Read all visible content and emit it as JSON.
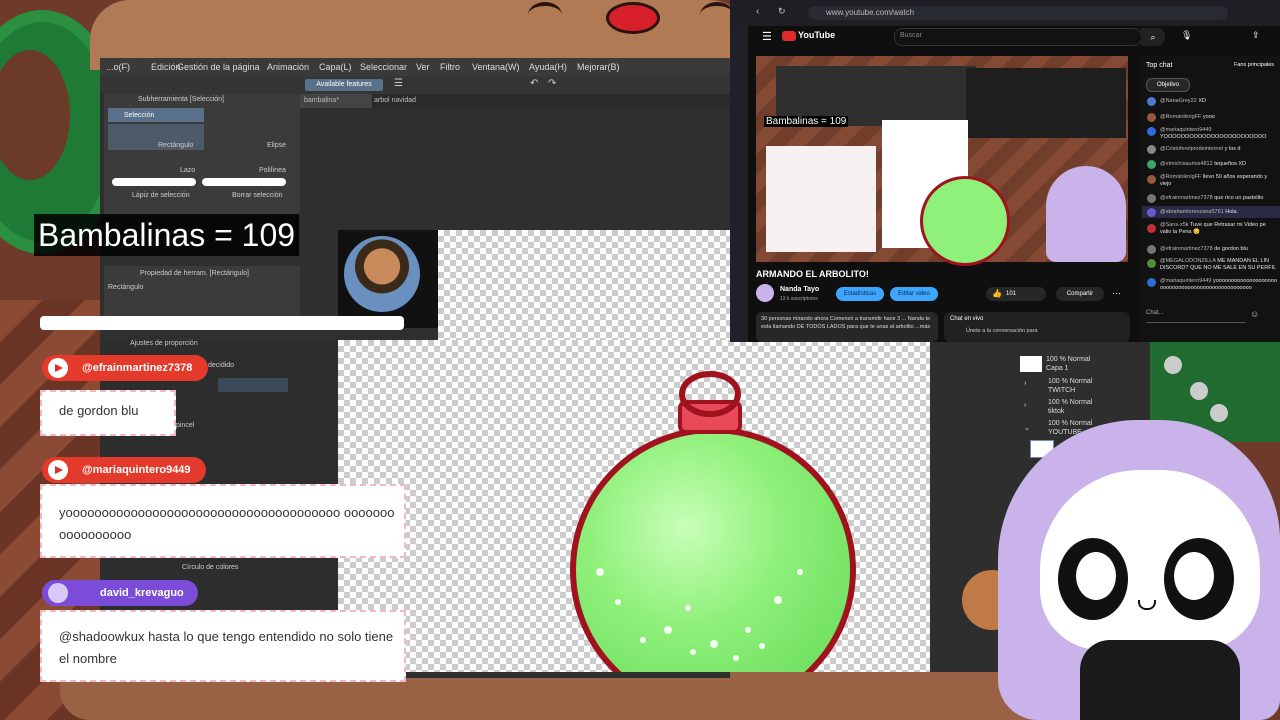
{
  "overlay": {
    "counter": "Bambalinas = 109"
  },
  "clipstudio": {
    "menu": [
      "...o(F)",
      "Edición",
      "Gestión de la página",
      "Animación",
      "Capa(L)",
      "Seleccionar",
      "Ver",
      "Filtro",
      "Ventana(W)",
      "Ayuda(H)",
      "Mejorar(B)"
    ],
    "available_features": "Available features",
    "tab_active": "bambalina*",
    "tab_inactive": "arbol navidad",
    "subtool_header": "Subherramienta [Selección]",
    "subtool_group": "Selección",
    "tools": [
      "Rectángulo",
      "Elipse",
      "Lazo",
      "Polilínea",
      "Lápiz de selección",
      "Borrar selección"
    ],
    "tool_property_header": "Propiedad de herram. [Rectángulo]",
    "tool_property_value": "Rectángulo",
    "proportion_label": "Ajustes de proporción",
    "decided_label": "decidido",
    "brush_label": "pincel",
    "color_circle_label": "Círculo de colores"
  },
  "chat_overlay": [
    {
      "user": "@efrainmartinez7378",
      "platform": "youtube",
      "message": "de gordon blu"
    },
    {
      "user": "@mariaquintero9449",
      "platform": "youtube",
      "message": "yoooooooooooooooooooooooooooooooooooooo ooooooooooooooooo"
    },
    {
      "user": "david_krevaguo",
      "platform": "twitch",
      "message": "@shadoowkux hasta lo que tengo entendido no solo tiene el nombre"
    }
  ],
  "youtube": {
    "url": "www.youtube.com/watch",
    "brand": "YouTube",
    "search_placeholder": "Buscar",
    "video_overlay_text": "Bambalinas = 109",
    "title": "ARMANDO EL ARBOLITO!",
    "channel": "Nanda Tayo",
    "subscribers": "13 k suscriptores",
    "btn_stats": "Estadísticas",
    "btn_edit": "Editar video",
    "likes": "101",
    "share": "Compartir",
    "description": "30 personas mirando ahora  Comenzó a transmitir hace 3 ... Nanda te esta llamando DE TODOS LADOS para que te unas al arbolito ...más",
    "live_chat_label": "Chat en vivo",
    "live_chat_join": "Únete a la conversación para",
    "top_chat": "Top chat",
    "top_fans": "Fans principales",
    "objective": "Objetivo",
    "chat_placeholder": "Chat...",
    "chat": [
      {
        "user": "@NanaGrey22",
        "msg": "XD",
        "color": "#4a7bd0"
      },
      {
        "user": "@RomániknigFF",
        "msg": "yooo",
        "color": "#9a5a3a"
      },
      {
        "user": "@mariaquintero9449",
        "msg": "YOOOOOOOOOOOOOOOOOOOOOOOO",
        "color": "#2d6bd6"
      },
      {
        "user": "@Cristoferelprodeinternet",
        "msg": "y los d",
        "color": "#888888"
      },
      {
        "user": "@elmichisaurios4812",
        "msg": "tequeños XD",
        "color": "#3aa66a"
      },
      {
        "user": "@RomániknigFF",
        "msg": "llevo 50 años esperando y viejo",
        "color": "#9a5a3a"
      },
      {
        "user": "@efrainmartinez7378",
        "msg": "que rico un pastelito",
        "color": "#777777"
      },
      {
        "user": "@abrahamlorenzana5761",
        "msg": "Hola.",
        "color": "#6a5acd"
      },
      {
        "user": "@Sans-z5k",
        "msg": "Tuve que Retrasar mi Video pe valio la Pena 😔",
        "color": "#c03030"
      },
      {
        "user": "@efrainmartinez7378",
        "msg": "de gordon blu",
        "color": "#777777"
      },
      {
        "user": "@MEGALODONZILLA",
        "msg": "ME MANDAN EL LIN DISCORD? QUE NO ME SALE EN SU PERFIL",
        "color": "#5a8a3a"
      },
      {
        "user": "@mariaquintero9449",
        "msg": "yoooooooooooooooooooooooooooooooooooooooooooooooooo",
        "color": "#2d6bd6"
      }
    ]
  },
  "layers": [
    {
      "pct": "100 % Normal",
      "name": "Capa 1"
    },
    {
      "pct": "100 % Normal",
      "name": "TWITCH"
    },
    {
      "pct": "100 % Normal",
      "name": "tiktok"
    },
    {
      "pct": "100 % Normal",
      "name": "YOUTUBE"
    }
  ],
  "colors": {
    "youtube_red": "#e32b2b",
    "twitch_purple": "#7a4cd8",
    "ornament_green": "#8ff07a",
    "ornament_rim": "#a0121e"
  }
}
